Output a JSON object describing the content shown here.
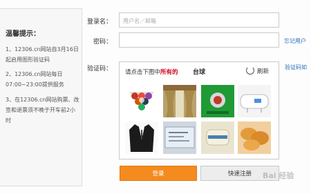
{
  "tips": {
    "title": "温馨提示：",
    "items": [
      "1、12306.cn网站自3月16日起启用图形验证码",
      "2、12306.cn网站每日07:00~23:00提供服务",
      "3、在12306.cn网站购票、改签和退票须不晚于开车前2小时"
    ]
  },
  "form": {
    "username_label": "登录名：",
    "username_placeholder": "用户名／邮箱",
    "password_label": "密码：",
    "captcha_label": "验证码：",
    "forgot_link": "忘记用户",
    "captcha_help_link": "验证码如"
  },
  "captcha": {
    "prompt_prefix": "请点击下图中",
    "prompt_highlight": "所有的",
    "target": "台球",
    "refresh_label": "刷新",
    "tiles": [
      {
        "icon": "billiard-balls-image"
      },
      {
        "icon": "curtain-image"
      },
      {
        "icon": "billiard-table-image"
      },
      {
        "icon": "water-heater-image"
      },
      {
        "icon": "suit-jacket-image"
      },
      {
        "icon": "ticket-image"
      },
      {
        "icon": "ceramic-cylinder-image"
      },
      {
        "icon": "fried-food-image"
      }
    ]
  },
  "buttons": {
    "login_label": "登录",
    "register_label": "快速注册"
  },
  "watermark": "Bai 经验",
  "colors": {
    "login_button": "#f38b1f",
    "link": "#2a6fb8",
    "highlight": "#d0021b"
  }
}
